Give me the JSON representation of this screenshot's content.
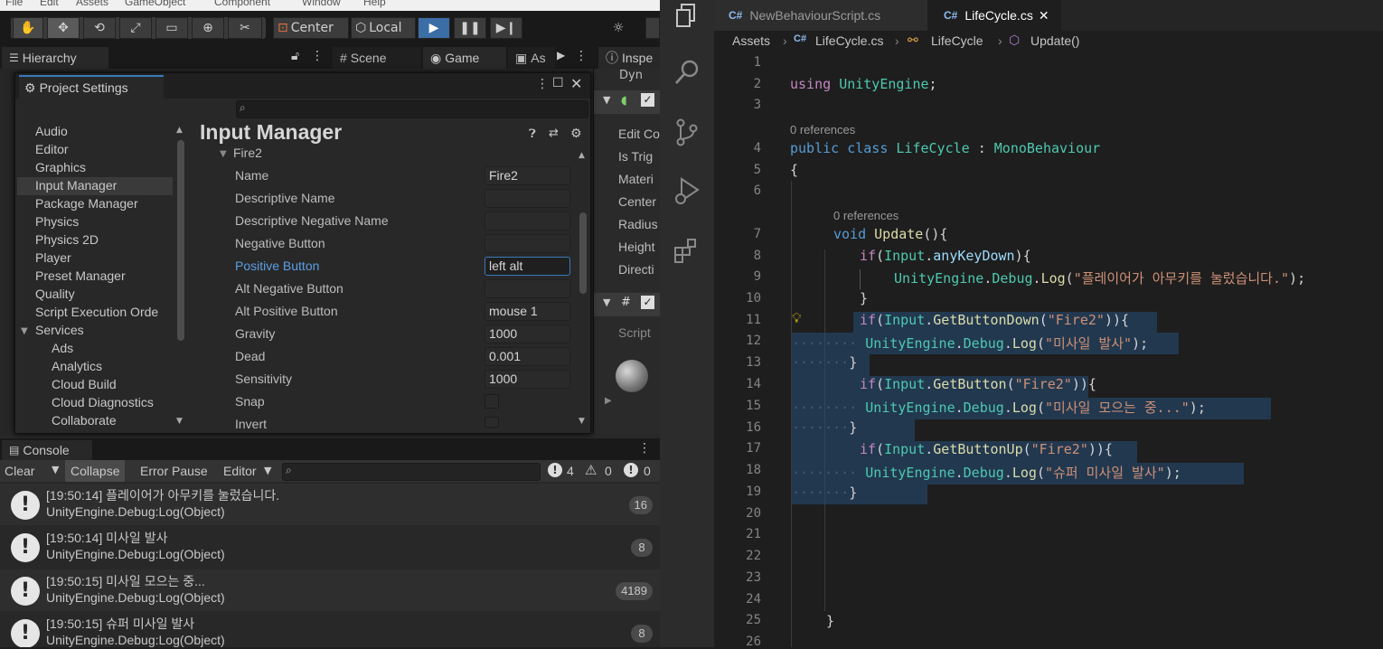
{
  "unity": {
    "menu": [
      "File",
      "Edit",
      "Assets",
      "GameObject",
      "Component",
      "Window",
      "Help"
    ],
    "toolbar": {
      "center": "Center",
      "local": "Local"
    },
    "tabs": {
      "hierarchy": "Hierarchy",
      "scene": "Scene",
      "game": "Game",
      "asset": "As",
      "inspector": "Inspe",
      "inspector_sub": "Dyn"
    },
    "inspector_labels": [
      "Edit Co",
      "Is Trig",
      "Materi",
      "Center",
      "Radius",
      "Height",
      "Directi",
      "Script"
    ],
    "project_settings": {
      "title": "Project Settings",
      "nav": [
        "Audio",
        "Editor",
        "Graphics",
        "Input Manager",
        "Package Manager",
        "Physics",
        "Physics 2D",
        "Player",
        "Preset Manager",
        "Quality",
        "Script Execution Orde",
        "Services",
        "Ads",
        "Analytics",
        "Cloud Build",
        "Cloud Diagnostics",
        "Collaborate"
      ],
      "heading": "Input Manager",
      "group": "Fire2",
      "props": [
        {
          "label": "Name",
          "value": "Fire2"
        },
        {
          "label": "Descriptive Name",
          "value": ""
        },
        {
          "label": "Descriptive Negative Name",
          "value": ""
        },
        {
          "label": "Negative Button",
          "value": ""
        },
        {
          "label": "Positive Button",
          "value": "left alt"
        },
        {
          "label": "Alt Negative Button",
          "value": ""
        },
        {
          "label": "Alt Positive Button",
          "value": "mouse 1"
        },
        {
          "label": "Gravity",
          "value": "1000"
        },
        {
          "label": "Dead",
          "value": "0.001"
        },
        {
          "label": "Sensitivity",
          "value": "1000"
        },
        {
          "label": "Snap",
          "value": ""
        },
        {
          "label": "Invert",
          "value": ""
        }
      ]
    },
    "console": {
      "title": "Console",
      "buttons": {
        "clear": "Clear",
        "collapse": "Collapse",
        "error_pause": "Error Pause",
        "editor": "Editor"
      },
      "counts": {
        "messages": "4",
        "warnings": "0",
        "errors": "0"
      },
      "rows": [
        {
          "line1": "[19:50:14] 플레이어가 아무키를 눌렀습니다.",
          "line2": "UnityEngine.Debug:Log(Object)",
          "count": "16"
        },
        {
          "line1": "[19:50:14] 미사일 발사",
          "line2": "UnityEngine.Debug:Log(Object)",
          "count": "8"
        },
        {
          "line1": "[19:50:15] 미사일 모으는 중...",
          "line2": "UnityEngine.Debug:Log(Object)",
          "count": "4189"
        },
        {
          "line1": "[19:50:15] 슈퍼 미사일 발사",
          "line2": "UnityEngine.Debug:Log(Object)",
          "count": "8"
        }
      ]
    }
  },
  "vscode": {
    "tabs": [
      {
        "label": "NewBehaviourScript.cs",
        "active": false
      },
      {
        "label": "LifeCycle.cs",
        "active": true
      }
    ],
    "close_glyph": "✕",
    "breadcrumb": [
      "Assets",
      "LifeCycle.cs",
      "LifeCycle",
      "Update()"
    ],
    "code": {
      "using_kw": "using",
      "using_ns": "UnityEngine",
      "semicolon": ";",
      "refs": "0 references",
      "class_decl_kw": "public class",
      "class_name": "LifeCycle",
      "colon": ":",
      "base": "MonoBehaviour",
      "open_brace": "{",
      "close_brace": "}",
      "void_kw": "void",
      "update_fn": "Update",
      "paren_open": "(){",
      "if_kw": "if",
      "input": "Input",
      "any_key": "anyKeyDown",
      "get_button_down": "GetButtonDown",
      "get_button": "GetButton",
      "get_button_up": "GetButtonUp",
      "fire2_str": "\"Fire2\"",
      "debug_ns": "UnityEngine",
      "debug_cls": "Debug",
      "log_fn": "Log",
      "msg1": "\"플레이어가 아무키를 눌렀습니다.\"",
      "msg2": "\"미사일 발사\"",
      "msg3": "\"미사일 모으는 중...\"",
      "msg4": "\"슈퍼 미사일 발사\""
    },
    "line_numbers": [
      "1",
      "2",
      "3",
      "4",
      "5",
      "6",
      "7",
      "8",
      "9",
      "10",
      "11",
      "12",
      "13",
      "14",
      "15",
      "16",
      "17",
      "18",
      "19",
      "20",
      "21",
      "22",
      "23",
      "24",
      "25",
      "26"
    ]
  }
}
